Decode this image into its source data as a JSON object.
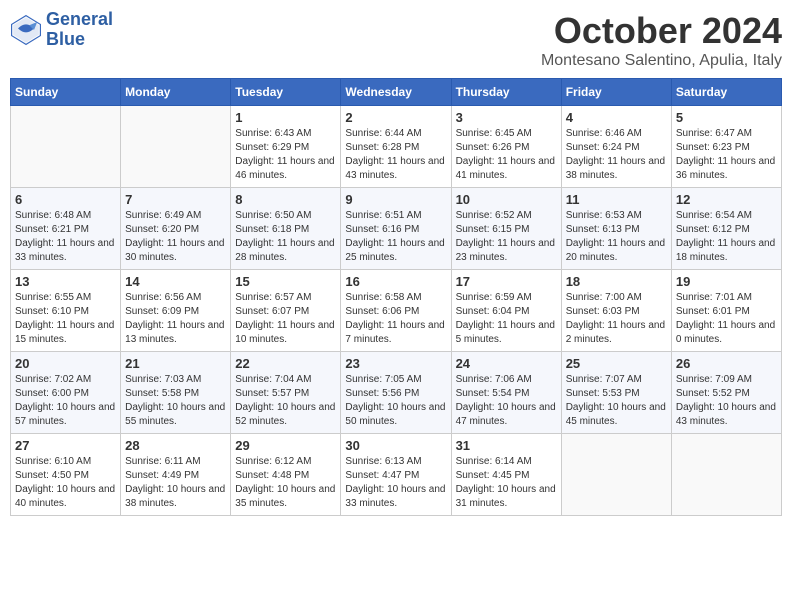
{
  "header": {
    "logo_line1": "General",
    "logo_line2": "Blue",
    "month": "October 2024",
    "location": "Montesano Salentino, Apulia, Italy"
  },
  "days_of_week": [
    "Sunday",
    "Monday",
    "Tuesday",
    "Wednesday",
    "Thursday",
    "Friday",
    "Saturday"
  ],
  "weeks": [
    [
      {
        "day": "",
        "info": ""
      },
      {
        "day": "",
        "info": ""
      },
      {
        "day": "1",
        "info": "Sunrise: 6:43 AM\nSunset: 6:29 PM\nDaylight: 11 hours and 46 minutes."
      },
      {
        "day": "2",
        "info": "Sunrise: 6:44 AM\nSunset: 6:28 PM\nDaylight: 11 hours and 43 minutes."
      },
      {
        "day": "3",
        "info": "Sunrise: 6:45 AM\nSunset: 6:26 PM\nDaylight: 11 hours and 41 minutes."
      },
      {
        "day": "4",
        "info": "Sunrise: 6:46 AM\nSunset: 6:24 PM\nDaylight: 11 hours and 38 minutes."
      },
      {
        "day": "5",
        "info": "Sunrise: 6:47 AM\nSunset: 6:23 PM\nDaylight: 11 hours and 36 minutes."
      }
    ],
    [
      {
        "day": "6",
        "info": "Sunrise: 6:48 AM\nSunset: 6:21 PM\nDaylight: 11 hours and 33 minutes."
      },
      {
        "day": "7",
        "info": "Sunrise: 6:49 AM\nSunset: 6:20 PM\nDaylight: 11 hours and 30 minutes."
      },
      {
        "day": "8",
        "info": "Sunrise: 6:50 AM\nSunset: 6:18 PM\nDaylight: 11 hours and 28 minutes."
      },
      {
        "day": "9",
        "info": "Sunrise: 6:51 AM\nSunset: 6:16 PM\nDaylight: 11 hours and 25 minutes."
      },
      {
        "day": "10",
        "info": "Sunrise: 6:52 AM\nSunset: 6:15 PM\nDaylight: 11 hours and 23 minutes."
      },
      {
        "day": "11",
        "info": "Sunrise: 6:53 AM\nSunset: 6:13 PM\nDaylight: 11 hours and 20 minutes."
      },
      {
        "day": "12",
        "info": "Sunrise: 6:54 AM\nSunset: 6:12 PM\nDaylight: 11 hours and 18 minutes."
      }
    ],
    [
      {
        "day": "13",
        "info": "Sunrise: 6:55 AM\nSunset: 6:10 PM\nDaylight: 11 hours and 15 minutes."
      },
      {
        "day": "14",
        "info": "Sunrise: 6:56 AM\nSunset: 6:09 PM\nDaylight: 11 hours and 13 minutes."
      },
      {
        "day": "15",
        "info": "Sunrise: 6:57 AM\nSunset: 6:07 PM\nDaylight: 11 hours and 10 minutes."
      },
      {
        "day": "16",
        "info": "Sunrise: 6:58 AM\nSunset: 6:06 PM\nDaylight: 11 hours and 7 minutes."
      },
      {
        "day": "17",
        "info": "Sunrise: 6:59 AM\nSunset: 6:04 PM\nDaylight: 11 hours and 5 minutes."
      },
      {
        "day": "18",
        "info": "Sunrise: 7:00 AM\nSunset: 6:03 PM\nDaylight: 11 hours and 2 minutes."
      },
      {
        "day": "19",
        "info": "Sunrise: 7:01 AM\nSunset: 6:01 PM\nDaylight: 11 hours and 0 minutes."
      }
    ],
    [
      {
        "day": "20",
        "info": "Sunrise: 7:02 AM\nSunset: 6:00 PM\nDaylight: 10 hours and 57 minutes."
      },
      {
        "day": "21",
        "info": "Sunrise: 7:03 AM\nSunset: 5:58 PM\nDaylight: 10 hours and 55 minutes."
      },
      {
        "day": "22",
        "info": "Sunrise: 7:04 AM\nSunset: 5:57 PM\nDaylight: 10 hours and 52 minutes."
      },
      {
        "day": "23",
        "info": "Sunrise: 7:05 AM\nSunset: 5:56 PM\nDaylight: 10 hours and 50 minutes."
      },
      {
        "day": "24",
        "info": "Sunrise: 7:06 AM\nSunset: 5:54 PM\nDaylight: 10 hours and 47 minutes."
      },
      {
        "day": "25",
        "info": "Sunrise: 7:07 AM\nSunset: 5:53 PM\nDaylight: 10 hours and 45 minutes."
      },
      {
        "day": "26",
        "info": "Sunrise: 7:09 AM\nSunset: 5:52 PM\nDaylight: 10 hours and 43 minutes."
      }
    ],
    [
      {
        "day": "27",
        "info": "Sunrise: 6:10 AM\nSunset: 4:50 PM\nDaylight: 10 hours and 40 minutes."
      },
      {
        "day": "28",
        "info": "Sunrise: 6:11 AM\nSunset: 4:49 PM\nDaylight: 10 hours and 38 minutes."
      },
      {
        "day": "29",
        "info": "Sunrise: 6:12 AM\nSunset: 4:48 PM\nDaylight: 10 hours and 35 minutes."
      },
      {
        "day": "30",
        "info": "Sunrise: 6:13 AM\nSunset: 4:47 PM\nDaylight: 10 hours and 33 minutes."
      },
      {
        "day": "31",
        "info": "Sunrise: 6:14 AM\nSunset: 4:45 PM\nDaylight: 10 hours and 31 minutes."
      },
      {
        "day": "",
        "info": ""
      },
      {
        "day": "",
        "info": ""
      }
    ]
  ]
}
